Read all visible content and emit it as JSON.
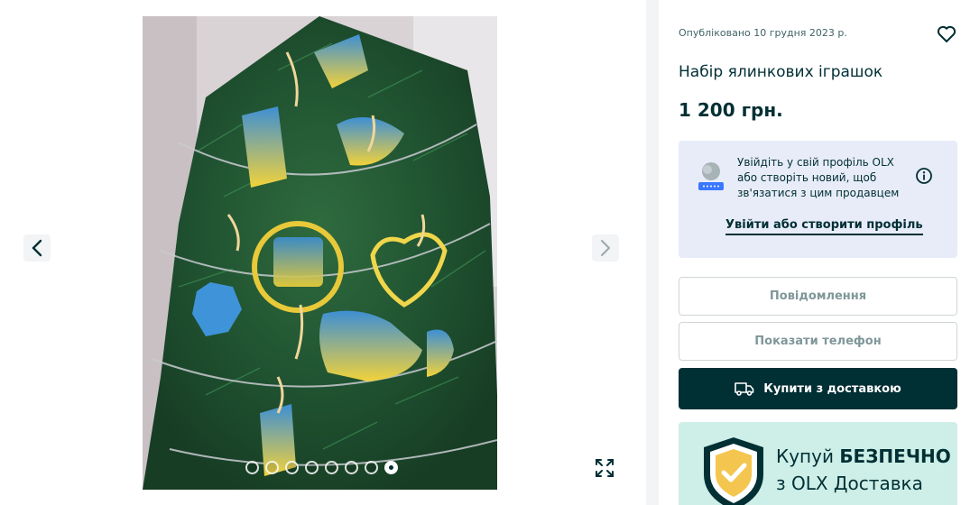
{
  "gallery": {
    "image_alt": "Набір ялинкових іграшок",
    "dot_count": 8,
    "active_index": 7
  },
  "listing": {
    "published": "Опубліковано 10 грудня 2023 р.",
    "title": "Набір ялинкових іграшок",
    "price": "1 200 грн."
  },
  "login_card": {
    "text": "Увійдіть у свій профіль OLX або створіть новий, щоб зв'язатися з цим продавцем",
    "link": "Увійти або створити профіль"
  },
  "actions": {
    "message": "Повідомлення",
    "show_phone": "Показати телефон",
    "buy_delivery": "Купити з доставкою"
  },
  "promo": {
    "line1_prefix": "Купуй ",
    "line1_bold": "БЕЗПЕЧНО",
    "line2": "з OLX Доставка"
  },
  "icons": {
    "prev": "chevron-left-icon",
    "next": "chevron-right-icon",
    "fullscreen": "expand-icon",
    "favorite": "heart-icon",
    "info": "info-icon",
    "truck": "truck-icon",
    "shield": "shield-check-icon"
  },
  "colors": {
    "brand_dark": "#002f34",
    "login_bg": "#e8ecf9",
    "promo_bg": "#cdefe8",
    "shield_gold": "#f4c64f"
  }
}
